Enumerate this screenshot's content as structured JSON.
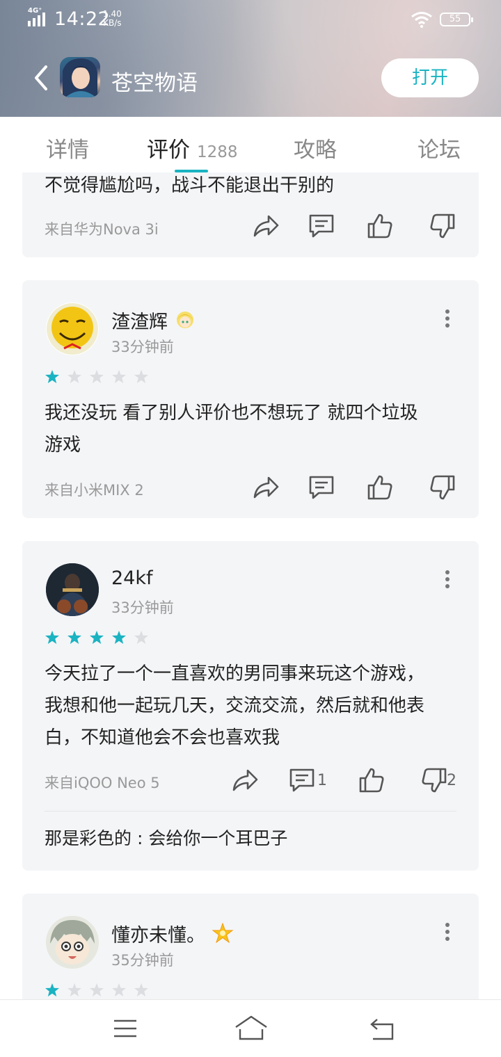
{
  "status_bar": {
    "network": "4G⁺",
    "time": "14:22",
    "speed_value": "1.40",
    "speed_unit": "KB/s",
    "battery": "55"
  },
  "header": {
    "app_name": "苍空物语",
    "open_label": "打开",
    "back_icon": "chevron-left-icon"
  },
  "tabs": [
    {
      "label": "详情"
    },
    {
      "label": "评价",
      "count": "1288"
    },
    {
      "label": "攻略"
    },
    {
      "label": "论坛"
    }
  ],
  "reviews": [
    {
      "text": "不觉得尴尬吗，战斗不能退出干别的",
      "device": "来自华为Nova 3i"
    },
    {
      "user": "渣渣辉",
      "time": "33分钟前",
      "rating": 1,
      "text_line1": "我还没玩 看了别人评价也不想玩了 就四个垃圾",
      "text_line2": "游戏",
      "device": "来自小米MIX 2"
    },
    {
      "user": "24kf",
      "time": "33分钟前",
      "rating": 4,
      "text_line1": "今天拉了一个一直喜欢的男同事来玩这个游戏，",
      "text_line2": "我想和他一起玩几天，交流交流，然后就和他表",
      "text_line3": "白，不知道他会不会也喜欢我",
      "device": "来自iQOO Neo 5",
      "comment_count": "1",
      "dislike_count": "2",
      "reply_author": "那是彩色的",
      "reply_sep": " : ",
      "reply_text": "会给你一个耳巴子"
    },
    {
      "user": "懂亦未懂。",
      "time": "35分钟前",
      "rating": 1
    }
  ],
  "colors": {
    "accent": "#1ab3c2",
    "star_empty": "#dcdde0",
    "card_bg": "#f4f5f7"
  },
  "icons": [
    "share-icon",
    "comment-icon",
    "thumbs-up-icon",
    "thumbs-down-icon",
    "more-icon",
    "menu-icon",
    "home-icon",
    "back-nav-icon"
  ]
}
